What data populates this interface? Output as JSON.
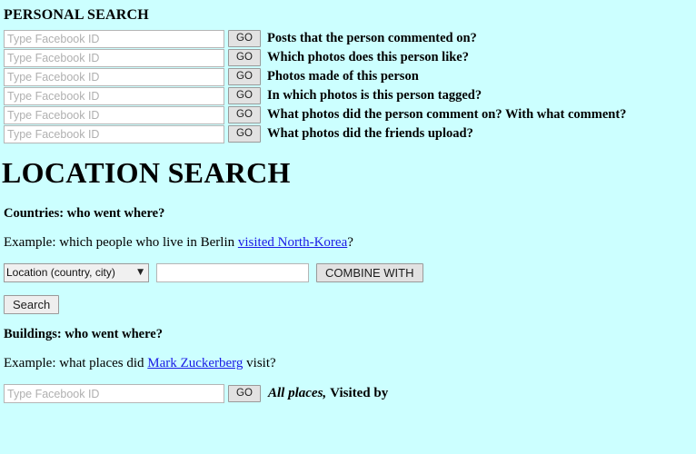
{
  "colors": {
    "background": "#CCFFFF",
    "link": "#1A1AE6",
    "button_face": "#E2E2E2",
    "input_border": "#B5B5B5"
  },
  "personal": {
    "title": "PERSONAL SEARCH",
    "input_placeholder": "Type Facebook ID",
    "go_label": "GO",
    "rows": [
      {
        "label": "Posts that the person commented on?"
      },
      {
        "label": "Which photos does this person like?"
      },
      {
        "label": "Photos made of this person"
      },
      {
        "label": "In which photos is this person tagged?"
      },
      {
        "label": "What photos did the person comment on? With what comment?"
      },
      {
        "label": "What photos did the friends upload?"
      }
    ]
  },
  "location": {
    "title": "LOCATION SEARCH",
    "countries": {
      "heading": "Countries: who went where?",
      "example_prefix": "Example: which people who live in Berlin ",
      "example_link": "visited North-Korea",
      "example_suffix": "?",
      "select_value": "Location (country, city)",
      "select_caret": "▼",
      "select_options": [
        "Location (country, city)"
      ],
      "text_value": "",
      "text_placeholder": "",
      "combine_label": "COMBINE WITH",
      "search_label": "Search"
    },
    "buildings": {
      "heading": "Buildings: who went where?",
      "example_prefix": "Example: what places did ",
      "example_link": "Mark Zuckerberg",
      "example_suffix": " visit?",
      "input_placeholder": "Type Facebook ID",
      "go_label": "GO",
      "all_places_label": "All places,",
      "visited_by_label": "Visited by"
    }
  }
}
